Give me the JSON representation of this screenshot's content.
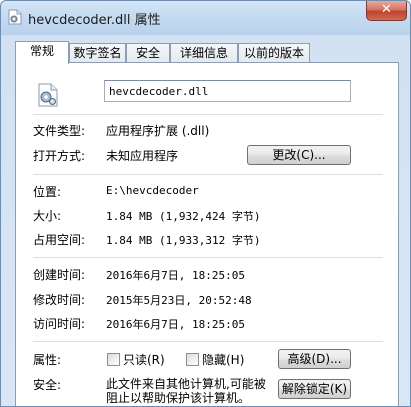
{
  "window": {
    "title": "hevcdecoder.dll 属性",
    "close_glyph": "✕"
  },
  "tabs": [
    {
      "label": "常规",
      "active": true
    },
    {
      "label": "数字签名",
      "active": false
    },
    {
      "label": "安全",
      "active": false
    },
    {
      "label": "详细信息",
      "active": false
    },
    {
      "label": "以前的版本",
      "active": false
    }
  ],
  "general": {
    "filename": "hevcdecoder.dll",
    "file_type_label": "文件类型:",
    "file_type_value": "应用程序扩展 (.dll)",
    "open_with_label": "打开方式:",
    "open_with_value": "未知应用程序",
    "change_button": "更改(C)...",
    "location_label": "位置:",
    "location_value": "E:\\hevcdecoder",
    "size_label": "大小:",
    "size_value": "1.84 MB (1,932,424 字节)",
    "size_on_disk_label": "占用空间:",
    "size_on_disk_value": "1.84 MB (1,933,312 字节)",
    "created_label": "创建时间:",
    "created_value": "2016年6月7日, 18:25:05",
    "modified_label": "修改时间:",
    "modified_value": "2015年5月23日, 20:52:48",
    "accessed_label": "访问时间:",
    "accessed_value": "2016年6月7日, 18:25:05",
    "attributes_label": "属性:",
    "readonly_label": "只读(R)",
    "hidden_label": "隐藏(H)",
    "advanced_button": "高级(D)...",
    "security_label": "安全:",
    "security_text": "此文件来自其他计算机,可能被阻止以帮助保护该计算机。",
    "unblock_button": "解除锁定(K)"
  }
}
